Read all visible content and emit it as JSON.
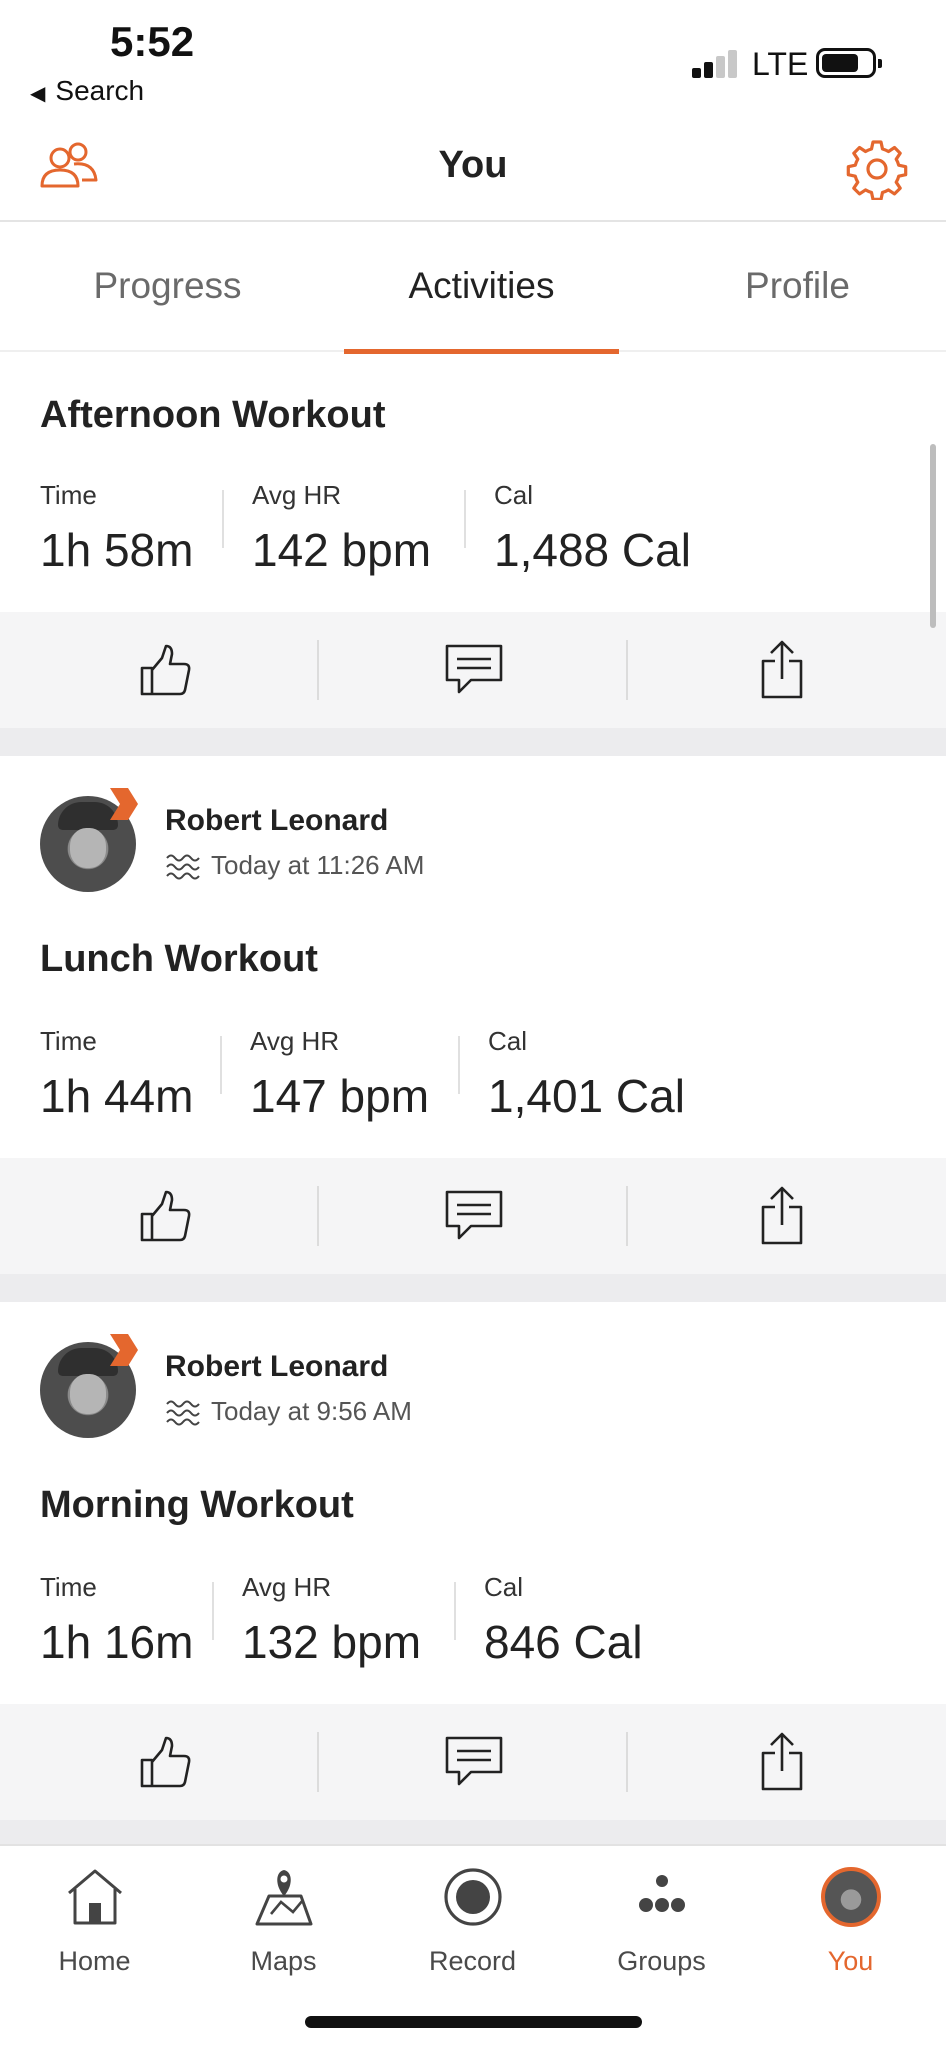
{
  "status_bar": {
    "time": "5:52",
    "back_label": "Search",
    "network": "LTE"
  },
  "header": {
    "title": "You"
  },
  "tabs": [
    {
      "label": "Progress",
      "active": false
    },
    {
      "label": "Activities",
      "active": true
    },
    {
      "label": "Profile",
      "active": false
    }
  ],
  "activities": [
    {
      "title": "Afternoon Workout",
      "stats": [
        {
          "label": "Time",
          "value": "1h 58m"
        },
        {
          "label": "Avg HR",
          "value": "142 bpm"
        },
        {
          "label": "Cal",
          "value": "1,488 Cal"
        }
      ]
    },
    {
      "author": "Robert Leonard",
      "timestamp": "Today at 11:26 AM",
      "title": "Lunch Workout",
      "stats": [
        {
          "label": "Time",
          "value": "1h 44m"
        },
        {
          "label": "Avg HR",
          "value": "147 bpm"
        },
        {
          "label": "Cal",
          "value": "1,401 Cal"
        }
      ]
    },
    {
      "author": "Robert Leonard",
      "timestamp": "Today at 9:56 AM",
      "title": "Morning Workout",
      "stats": [
        {
          "label": "Time",
          "value": "1h 16m"
        },
        {
          "label": "Avg HR",
          "value": "132 bpm"
        },
        {
          "label": "Cal",
          "value": "846 Cal"
        }
      ]
    }
  ],
  "tab_bar": [
    {
      "label": "Home",
      "icon": "home-icon"
    },
    {
      "label": "Maps",
      "icon": "map-icon"
    },
    {
      "label": "Record",
      "icon": "record-icon"
    },
    {
      "label": "Groups",
      "icon": "groups-icon"
    },
    {
      "label": "You",
      "icon": "avatar-icon",
      "active": true
    }
  ],
  "colors": {
    "accent": "#e4672e",
    "text": "#222222",
    "muted": "#6a6a6a",
    "action_bar": "#f5f5f6",
    "feed_bg": "#ececee"
  }
}
